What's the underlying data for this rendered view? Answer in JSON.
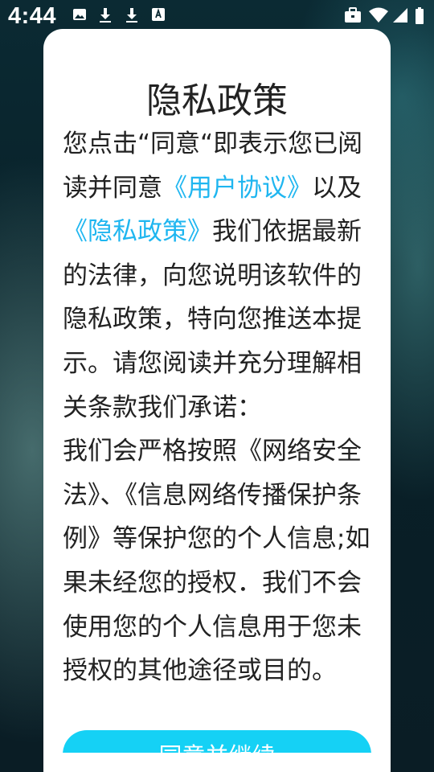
{
  "status_bar": {
    "time": "4:44",
    "left_icons": [
      "image-icon",
      "download-icon",
      "download-icon",
      "keyboard-a-icon"
    ],
    "right_icons": [
      "briefcase-icon",
      "wifi-icon",
      "signal-icon",
      "battery-icon"
    ]
  },
  "dialog": {
    "title": "隐私政策",
    "body": {
      "part1": "您点击“同意“即表示您已阅读并同意",
      "link_user_agreement": "《用户协议》",
      "part2": "以及",
      "link_privacy_policy": "《隐私政策》",
      "part3": "我们依据最新的法律，向您说明该软件的隐私政策，特向您推送本提示。请您阅读并充分理解相关条款我们承诺：",
      "part4": "我们会严格按照《网络安全法》、《信息网络传播保护条例》等保护您的个人信息;如果未经您的授权．我们不会使用您的个人信息用于您未授权的其他途径或目的。"
    },
    "agree_button_label": "同意并继续"
  },
  "colors": {
    "link": "#1fb6f0",
    "button": "#15d1f5",
    "background": "#0b2a33"
  }
}
